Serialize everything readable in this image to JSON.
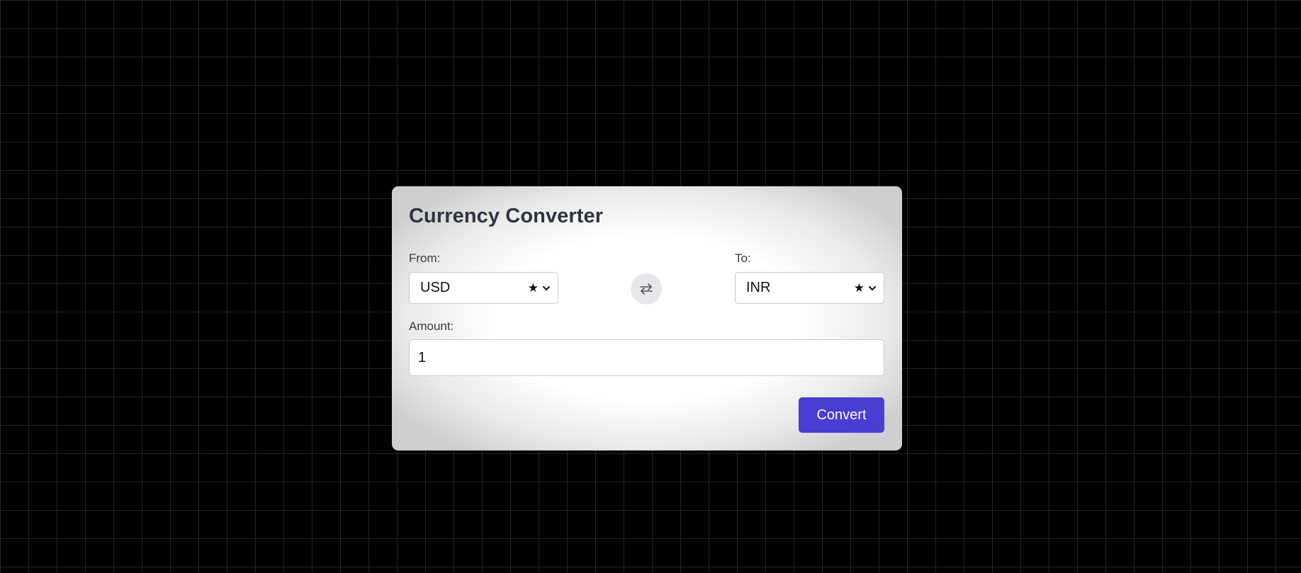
{
  "app": {
    "title": "Currency Converter"
  },
  "from": {
    "label": "From:",
    "value": "USD",
    "favorite_icon": "star-icon"
  },
  "to": {
    "label": "To:",
    "value": "INR",
    "favorite_icon": "star-icon"
  },
  "swap": {
    "icon": "swap-arrows-icon"
  },
  "amount": {
    "label": "Amount:",
    "value": "1"
  },
  "actions": {
    "convert_label": "Convert"
  },
  "colors": {
    "accent": "#4a3dd1",
    "title": "#2e3442",
    "background": "#000000"
  }
}
